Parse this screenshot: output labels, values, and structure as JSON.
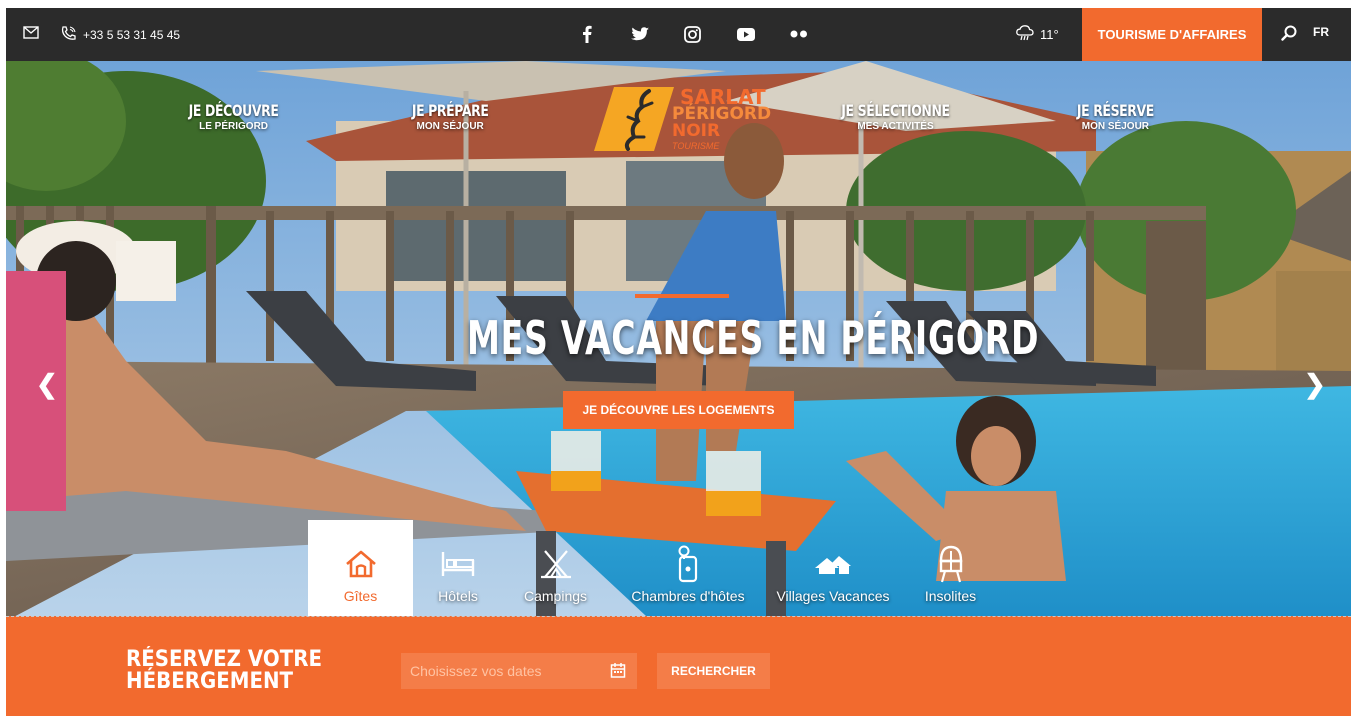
{
  "topbar": {
    "phone": "+33 5 53 31 45 45",
    "weather_temp": "11°",
    "business_button": "TOURISME D'AFFAIRES",
    "language": "FR",
    "social_icons": [
      "facebook-icon",
      "twitter-icon",
      "instagram-icon",
      "youtube-icon",
      "flickr-icon"
    ]
  },
  "nav": {
    "items": [
      {
        "title": "JE DÉCOUVRE",
        "subtitle": "LE PÉRIGORD"
      },
      {
        "title": "JE PRÉPARE",
        "subtitle": "MON SÉJOUR"
      },
      {
        "title": "JE SÉLECTIONNE",
        "subtitle": "MES ACTIVITÉS"
      },
      {
        "title": "JE RÉSERVE",
        "subtitle": "MON SÉJOUR"
      }
    ]
  },
  "logo": {
    "line1": "SARLAT",
    "line2": "PÉRIGORD",
    "line3": "NOIR",
    "line4": "TOURISME"
  },
  "hero": {
    "title": "MES VACANCES EN PÉRIGORD",
    "cta": "JE DÉCOUVRE LES LOGEMENTS"
  },
  "categories": [
    {
      "label": "Gîtes",
      "icon": "house-icon",
      "active": true
    },
    {
      "label": "Hôtels",
      "icon": "bed-icon",
      "active": false
    },
    {
      "label": "Campings",
      "icon": "tent-icon",
      "active": false
    },
    {
      "label": "Chambres d'hôtes",
      "icon": "key-icon",
      "active": false
    },
    {
      "label": "Villages Vacances",
      "icon": "village-icon",
      "active": false
    },
    {
      "label": "Insolites",
      "icon": "treehouse-icon",
      "active": false
    }
  ],
  "booking": {
    "title": "RÉSERVEZ VOTRE HÉBERGEMENT",
    "date_placeholder": "Choisissez vos dates",
    "search_button": "RECHERCHER"
  },
  "colors": {
    "accent": "#f26a2e",
    "topbar": "#2b2b2b"
  }
}
